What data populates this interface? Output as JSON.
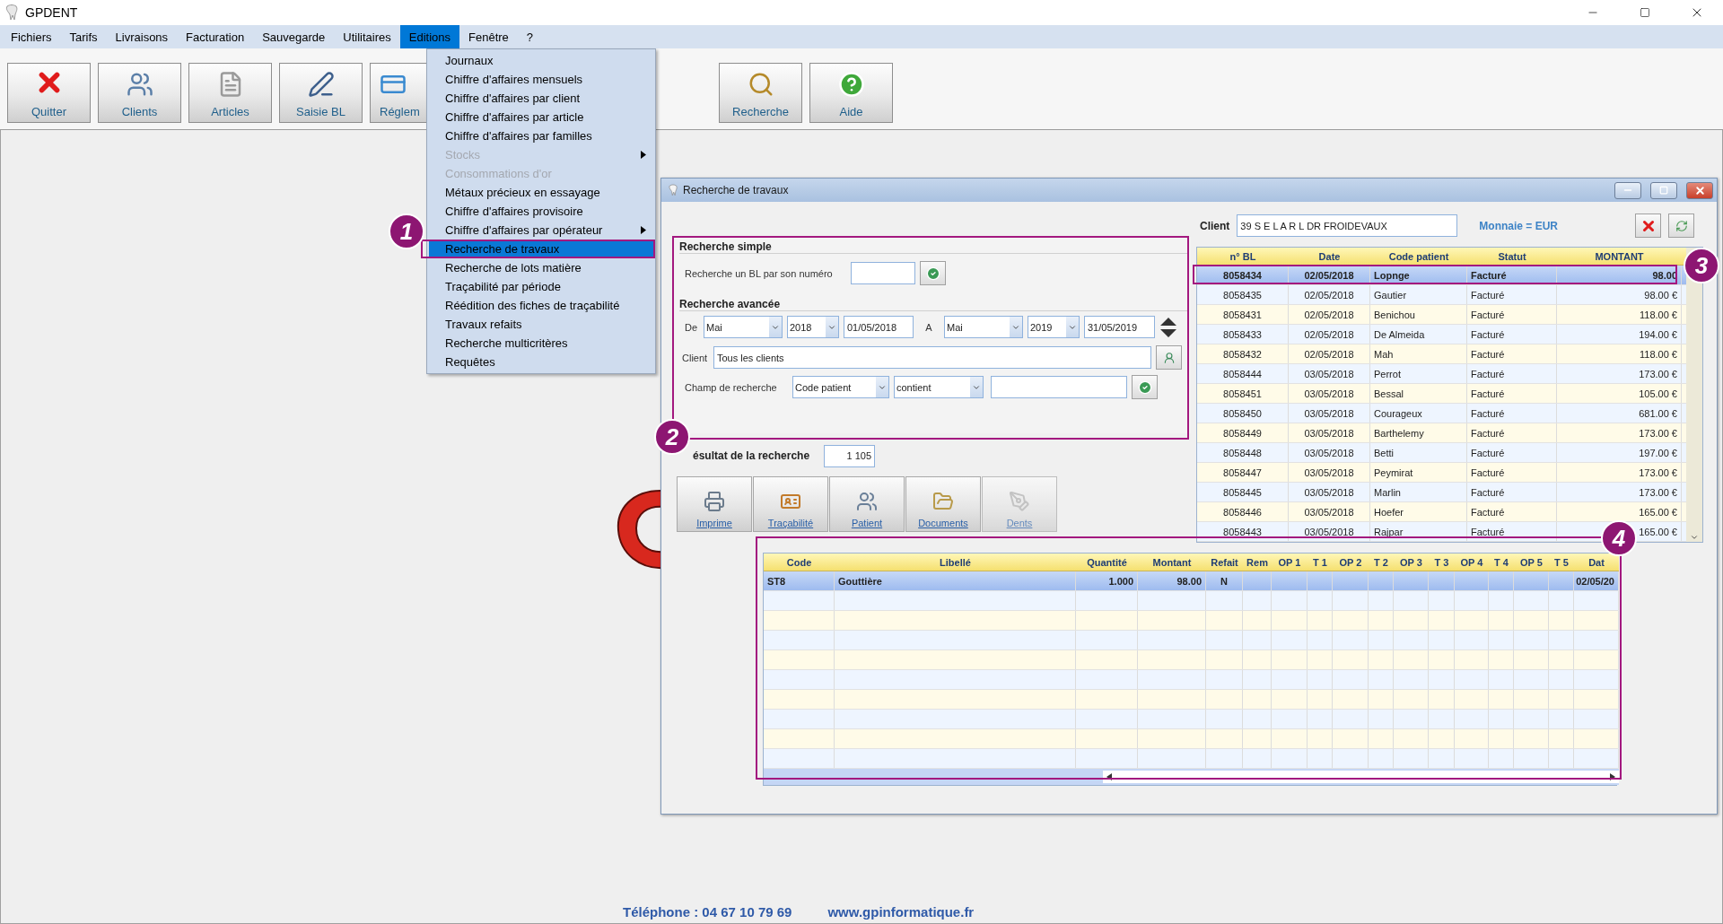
{
  "window": {
    "title": "GPDENT"
  },
  "menu_bar": [
    {
      "label": "Fichiers",
      "selected": false
    },
    {
      "label": "Tarifs",
      "selected": false
    },
    {
      "label": "Livraisons",
      "selected": false
    },
    {
      "label": "Facturation",
      "selected": false
    },
    {
      "label": "Sauvegarde",
      "selected": false
    },
    {
      "label": "Utilitaires",
      "selected": false
    },
    {
      "label": "Editions",
      "selected": true
    },
    {
      "label": "Fenêtre",
      "selected": false
    },
    {
      "label": "?",
      "selected": false
    }
  ],
  "toolbar": {
    "main": [
      {
        "label": "Quitter",
        "kind": "quit"
      },
      {
        "label": "Clients",
        "kind": "clients"
      },
      {
        "label": "Articles",
        "kind": "articles"
      },
      {
        "label": "Saisie BL",
        "kind": "entry"
      },
      {
        "label": "Réglem",
        "kind": "payment"
      }
    ],
    "extra": [
      {
        "label": "Recherche",
        "kind": "search"
      },
      {
        "label": "Aide",
        "kind": "help"
      }
    ]
  },
  "editions_menu": [
    {
      "label": "Journaux",
      "disabled": false,
      "selected": false,
      "submenu": false
    },
    {
      "label": "Chiffre d'affaires mensuels",
      "disabled": false,
      "selected": false,
      "submenu": false
    },
    {
      "label": "Chiffre d'affaires par client",
      "disabled": false,
      "selected": false,
      "submenu": false
    },
    {
      "label": "Chiffre d'affaires par article",
      "disabled": false,
      "selected": false,
      "submenu": false
    },
    {
      "label": "Chiffre d'affaires par familles",
      "disabled": false,
      "selected": false,
      "submenu": false
    },
    {
      "label": "Stocks",
      "disabled": true,
      "selected": false,
      "submenu": true
    },
    {
      "label": "Consommations d'or",
      "disabled": true,
      "selected": false,
      "submenu": false
    },
    {
      "label": "Métaux précieux en essayage",
      "disabled": false,
      "selected": false,
      "submenu": false
    },
    {
      "label": "Chiffre d'affaires provisoire",
      "disabled": false,
      "selected": false,
      "submenu": false
    },
    {
      "label": "Chiffre d'affaires par opérateur",
      "disabled": false,
      "selected": false,
      "submenu": true
    },
    {
      "label": "Recherche de travaux",
      "disabled": false,
      "selected": true,
      "submenu": false
    },
    {
      "label": "Recherche de lots matière",
      "disabled": false,
      "selected": false,
      "submenu": false
    },
    {
      "label": "Traçabilité par période",
      "disabled": false,
      "selected": false,
      "submenu": false
    },
    {
      "label": "Réédition des fiches de traçabilité",
      "disabled": false,
      "selected": false,
      "submenu": false
    },
    {
      "label": "Travaux refaits",
      "disabled": false,
      "selected": false,
      "submenu": false
    },
    {
      "label": "Recherche multicritères",
      "disabled": false,
      "selected": false,
      "submenu": false
    },
    {
      "label": "Requêtes",
      "disabled": false,
      "selected": false,
      "submenu": false
    }
  ],
  "dialog": {
    "title": "Recherche de travaux",
    "simple_search": {
      "heading": "Recherche simple",
      "label": "Recherche un BL par son numéro"
    },
    "advanced_search": {
      "heading": "Recherche avancée",
      "from_label": "De",
      "from_month": "Mai",
      "from_year": "2018",
      "from_date": "01/05/2018",
      "to_label": "A",
      "to_month": "Mai",
      "to_year": "2019",
      "to_date": "31/05/2019",
      "client_label": "Client",
      "client_value": "Tous les clients",
      "field_label": "Champ de recherche",
      "field_value": "Code patient",
      "operator_value": "contient"
    },
    "result": {
      "label": "ésultat de la recherche",
      "count": "1 105"
    },
    "actions": [
      {
        "label": "Imprime",
        "kind": "printer",
        "disabled": false
      },
      {
        "label": "Traçabilité",
        "kind": "card",
        "disabled": false
      },
      {
        "label": "Patient",
        "kind": "people",
        "disabled": false
      },
      {
        "label": "Documents",
        "kind": "folder",
        "disabled": false
      },
      {
        "label": "Dents",
        "kind": "teeth",
        "disabled": true
      }
    ],
    "client": {
      "label": "Client",
      "value": "39 S E L A R L DR FROIDEVAUX"
    },
    "currency": "Monnaie = EUR",
    "jobs_table": {
      "columns": [
        "n° BL",
        "Date",
        "Code patient",
        "Statut",
        "MONTANT"
      ],
      "rows": [
        {
          "cells": [
            "8058434",
            "02/05/2018",
            "Lopnge",
            "Facturé",
            "98.00"
          ],
          "selected": true
        },
        {
          "cells": [
            "8058435",
            "02/05/2018",
            "Gautier",
            "Facturé",
            "98.00 €"
          ],
          "selected": false
        },
        {
          "cells": [
            "8058431",
            "02/05/2018",
            "Benichou",
            "Facturé",
            "118.00 €"
          ],
          "selected": false
        },
        {
          "cells": [
            "8058433",
            "02/05/2018",
            "De Almeida",
            "Facturé",
            "194.00 €"
          ],
          "selected": false
        },
        {
          "cells": [
            "8058432",
            "02/05/2018",
            "Mah",
            "Facturé",
            "118.00 €"
          ],
          "selected": false
        },
        {
          "cells": [
            "8058444",
            "03/05/2018",
            "Perrot",
            "Facturé",
            "173.00 €"
          ],
          "selected": false
        },
        {
          "cells": [
            "8058451",
            "03/05/2018",
            "Bessal",
            "Facturé",
            "105.00 €"
          ],
          "selected": false
        },
        {
          "cells": [
            "8058450",
            "03/05/2018",
            "Courageux",
            "Facturé",
            "681.00 €"
          ],
          "selected": false
        },
        {
          "cells": [
            "8058449",
            "03/05/2018",
            "Barthelemy",
            "Facturé",
            "173.00 €"
          ],
          "selected": false
        },
        {
          "cells": [
            "8058448",
            "03/05/2018",
            "Betti",
            "Facturé",
            "197.00 €"
          ],
          "selected": false
        },
        {
          "cells": [
            "8058447",
            "03/05/2018",
            "Peymirat",
            "Facturé",
            "173.00 €"
          ],
          "selected": false
        },
        {
          "cells": [
            "8058445",
            "03/05/2018",
            "Marlin",
            "Facturé",
            "173.00 €"
          ],
          "selected": false
        },
        {
          "cells": [
            "8058446",
            "03/05/2018",
            "Hoefer",
            "Facturé",
            "165.00 €"
          ],
          "selected": false
        },
        {
          "cells": [
            "8058443",
            "03/05/2018",
            "Rajpar",
            "Facturé",
            "165.00 €"
          ],
          "selected": false
        }
      ]
    },
    "lines_table": {
      "columns": [
        "Code",
        "Libellé",
        "Quantité",
        "Montant",
        "Refait",
        "Rem",
        "OP 1",
        "T 1",
        "OP 2",
        "T 2",
        "OP 3",
        "T 3",
        "OP 4",
        "T 4",
        "OP 5",
        "T 5",
        "Dat"
      ],
      "rows": [
        {
          "cells": [
            "ST8",
            "Gouttière",
            "1.000",
            "98.00",
            "N",
            "",
            "",
            "",
            "",
            "",
            "",
            "",
            "",
            "",
            "",
            "",
            "02/05/20"
          ],
          "selected": true
        }
      ]
    }
  },
  "annotations": [
    {
      "label": "1"
    },
    {
      "label": "2"
    },
    {
      "label": "3"
    },
    {
      "label": "4"
    }
  ],
  "footer": {
    "phone": "Téléphone : 04 67 10 79 69",
    "website": "www.gpinformatique.fr"
  }
}
